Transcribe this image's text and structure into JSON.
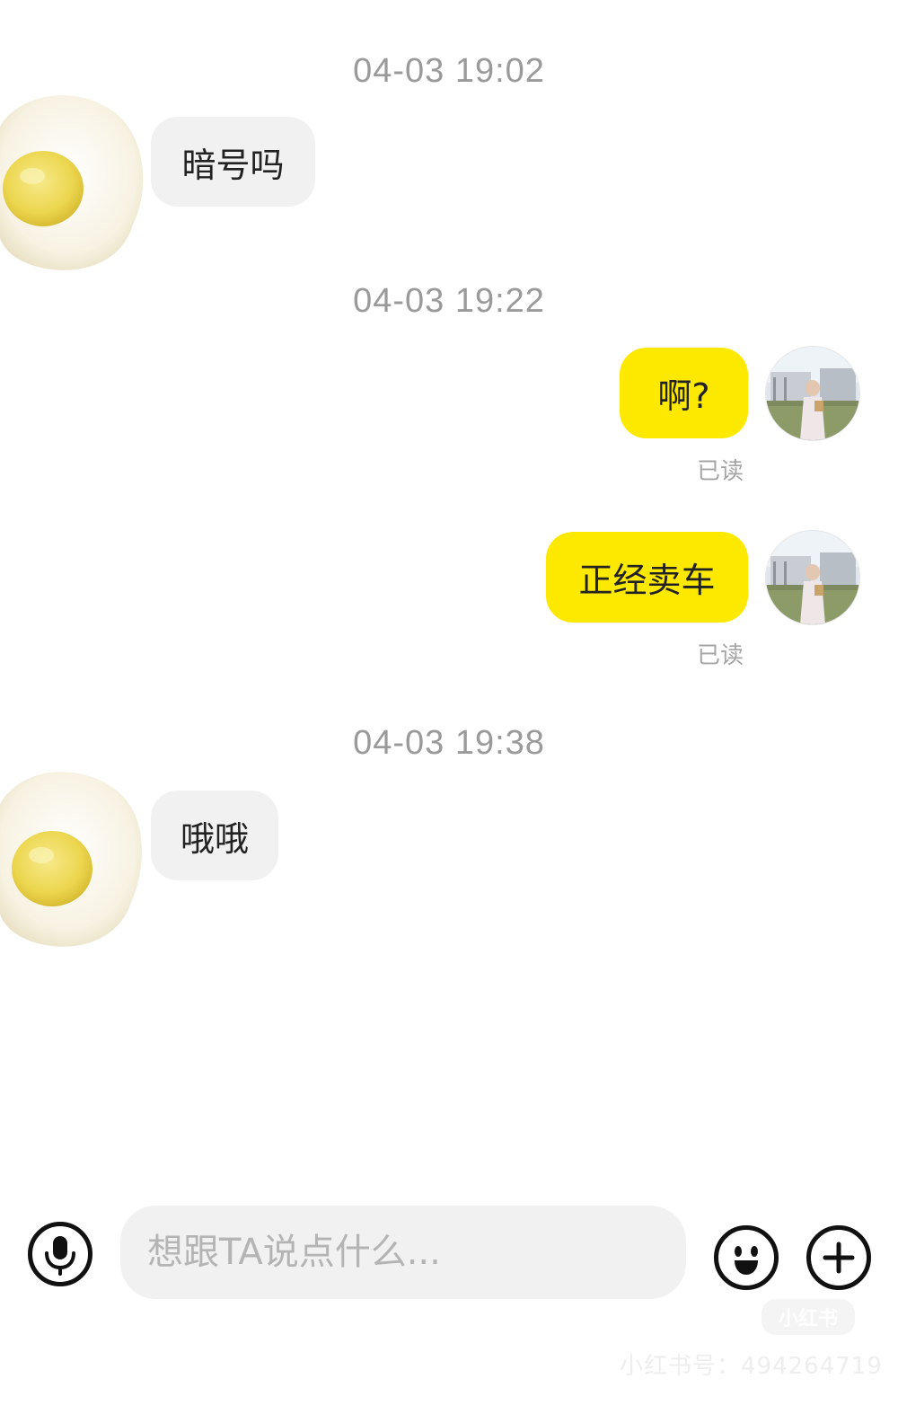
{
  "messages": [
    {
      "timestamp": "04-03 19:02",
      "text": "暗号吗"
    },
    {
      "timestamp": "04-03 19:22",
      "text": "啊?",
      "status": "已读"
    },
    {
      "text": "正经卖车",
      "status": "已读"
    },
    {
      "timestamp": "04-03 19:38",
      "text": "哦哦"
    }
  ],
  "input": {
    "placeholder": "想跟TA说点什么..."
  },
  "icons": {
    "voice": "microphone-icon",
    "emoji": "smiley-icon",
    "more": "plus-icon"
  },
  "colors": {
    "outgoing_bubble": "#fde800",
    "incoming_bubble": "#f1f1f1",
    "timestamp": "#9a9a9a"
  },
  "watermark": {
    "logo": "小红书",
    "id_text": "小红书号：494264719"
  }
}
